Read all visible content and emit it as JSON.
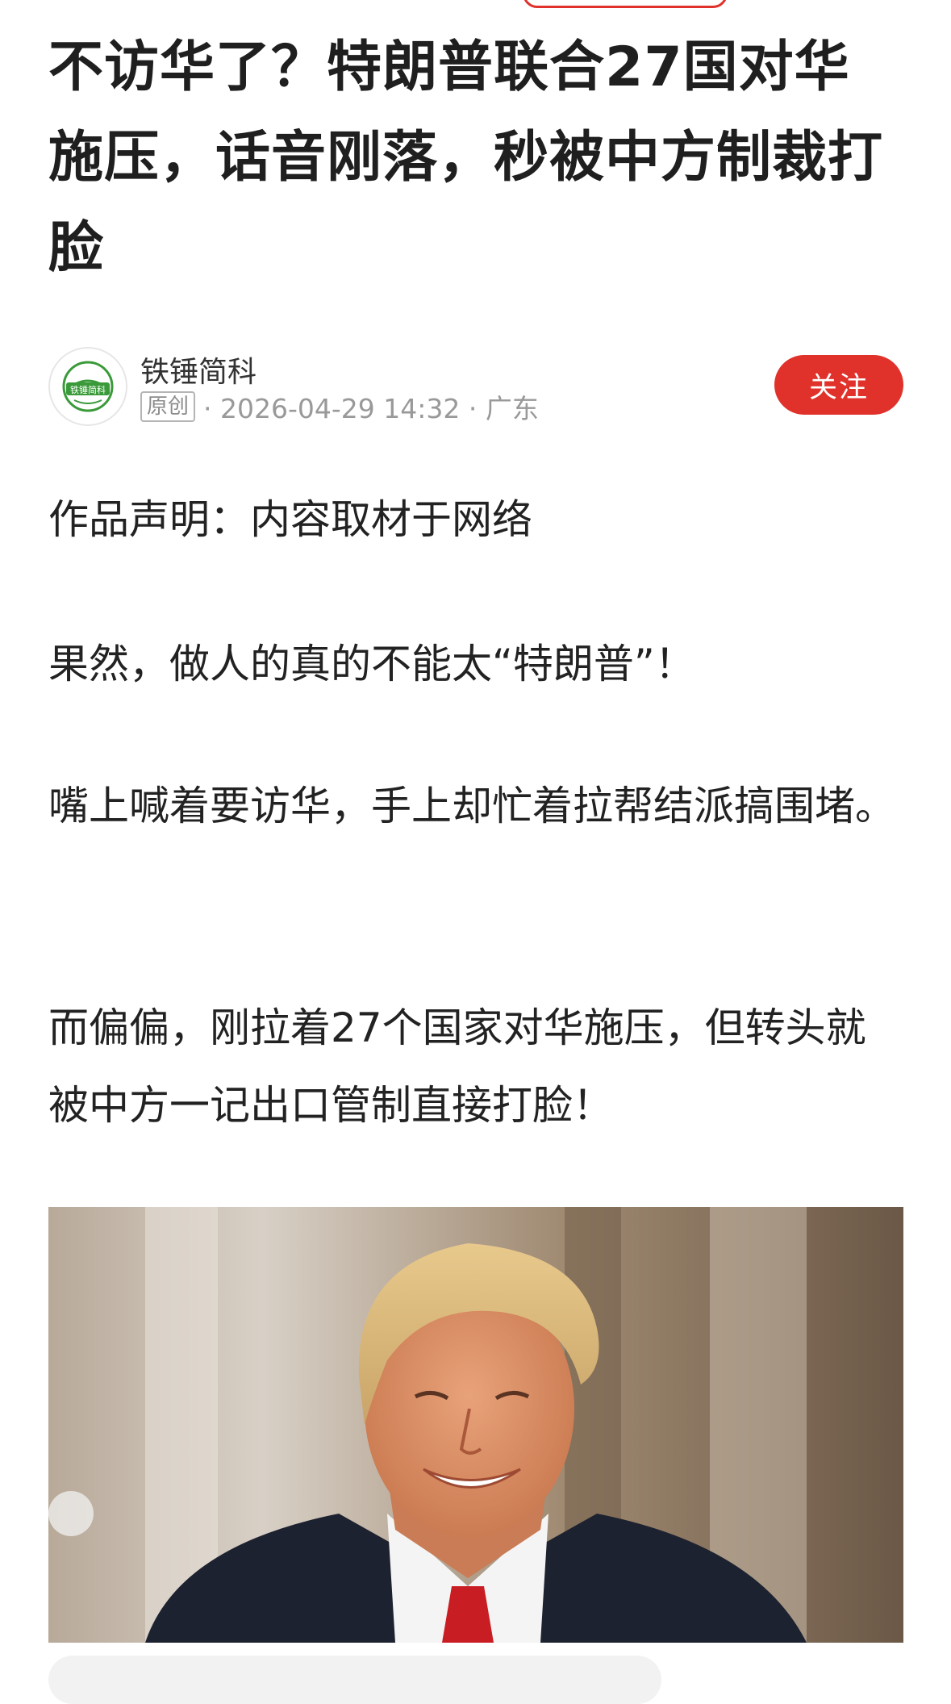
{
  "article": {
    "title": "不访华了？特朗普联合27国对华施压，话音刚落，秒被中方制裁打脸",
    "author": {
      "name": "铁锤简科",
      "avatar_text": "铁锤简科",
      "badge": "原创",
      "meta": "· 2026-04-29 14:32 · 广东"
    },
    "follow_label": "关注",
    "paragraphs": [
      "作品声明：内容取材于网络",
      "果然，做人的真的不能太“特朗普”！",
      "嘴上喊着要访华，手上却忙着拉帮结派搞围堵。",
      "而偏偏，刚拉着27个国家对华施压，但转头就被中方一记出口管制直接打脸！"
    ]
  },
  "colors": {
    "accent": "#e0322b",
    "avatar_green": "#3a9a3a",
    "text": "#222222",
    "meta": "#999999"
  },
  "icons": [
    "avatar-logo-icon"
  ]
}
